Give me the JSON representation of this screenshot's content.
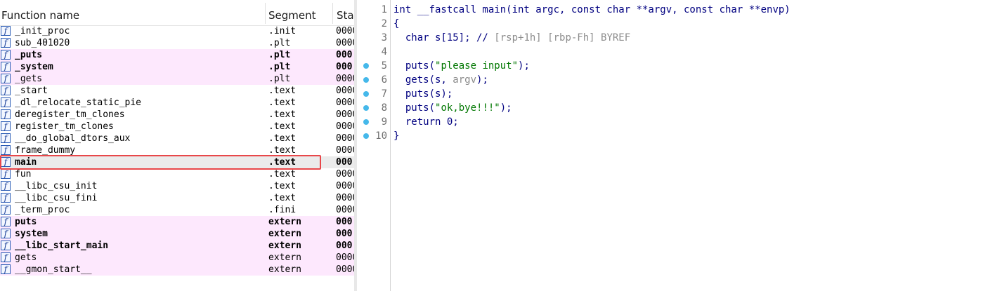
{
  "functions": {
    "columns": {
      "name": "Function name",
      "segment": "Segment",
      "start": "Start"
    },
    "rows": [
      {
        "name": "_init_proc",
        "segment": ".init",
        "start": "0000",
        "type": "normal"
      },
      {
        "name": "sub_401020",
        "segment": ".plt",
        "start": "0000",
        "type": "normal"
      },
      {
        "name": "_puts",
        "segment": ".plt",
        "start": "000",
        "type": "import"
      },
      {
        "name": "_system",
        "segment": ".plt",
        "start": "000",
        "type": "import"
      },
      {
        "name": "_gets",
        "segment": ".plt",
        "start": "0000",
        "type": "import-light"
      },
      {
        "name": "_start",
        "segment": ".text",
        "start": "0000",
        "type": "normal"
      },
      {
        "name": "_dl_relocate_static_pie",
        "segment": ".text",
        "start": "0000",
        "type": "normal"
      },
      {
        "name": "deregister_tm_clones",
        "segment": ".text",
        "start": "0000",
        "type": "normal"
      },
      {
        "name": "register_tm_clones",
        "segment": ".text",
        "start": "0000",
        "type": "normal"
      },
      {
        "name": "__do_global_dtors_aux",
        "segment": ".text",
        "start": "0000",
        "type": "normal"
      },
      {
        "name": "frame_dummy",
        "segment": ".text",
        "start": "0000",
        "type": "normal"
      },
      {
        "name": "main",
        "segment": ".text",
        "start": "000",
        "type": "selected"
      },
      {
        "name": "fun",
        "segment": ".text",
        "start": "0000",
        "type": "normal"
      },
      {
        "name": "__libc_csu_init",
        "segment": ".text",
        "start": "0000",
        "type": "normal"
      },
      {
        "name": "__libc_csu_fini",
        "segment": ".text",
        "start": "0000",
        "type": "normal"
      },
      {
        "name": "_term_proc",
        "segment": ".fini",
        "start": "0000",
        "type": "normal"
      },
      {
        "name": "puts",
        "segment": "extern",
        "start": "000",
        "type": "import"
      },
      {
        "name": "system",
        "segment": "extern",
        "start": "000",
        "type": "import"
      },
      {
        "name": "__libc_start_main",
        "segment": "extern",
        "start": "000",
        "type": "import"
      },
      {
        "name": "gets",
        "segment": "extern",
        "start": "0000",
        "type": "import-light"
      },
      {
        "name": "__gmon_start__",
        "segment": "extern",
        "start": "0000",
        "type": "import-light"
      }
    ]
  },
  "pseudocode": {
    "lines": [
      {
        "num": "1",
        "breakpoint": false,
        "parts": [
          {
            "t": "int __fastcall main(int argc, const char **argv, const char **envp)",
            "c": "code"
          }
        ]
      },
      {
        "num": "2",
        "breakpoint": false,
        "parts": [
          {
            "t": "{",
            "c": "code"
          }
        ]
      },
      {
        "num": "3",
        "breakpoint": false,
        "parts": [
          {
            "t": "  char s[15]; // ",
            "c": "code"
          },
          {
            "t": "[rsp+1h] [rbp-Fh] BYREF",
            "c": "gray"
          }
        ]
      },
      {
        "num": "4",
        "breakpoint": false,
        "parts": []
      },
      {
        "num": "5",
        "breakpoint": true,
        "parts": [
          {
            "t": "  puts(",
            "c": "code"
          },
          {
            "t": "\"please input\"",
            "c": "green"
          },
          {
            "t": ");",
            "c": "code"
          }
        ]
      },
      {
        "num": "6",
        "breakpoint": true,
        "parts": [
          {
            "t": "  gets(s, ",
            "c": "code"
          },
          {
            "t": "argv",
            "c": "gray"
          },
          {
            "t": ");",
            "c": "code"
          }
        ]
      },
      {
        "num": "7",
        "breakpoint": true,
        "parts": [
          {
            "t": "  puts(s);",
            "c": "code"
          }
        ]
      },
      {
        "num": "8",
        "breakpoint": true,
        "parts": [
          {
            "t": "  puts(",
            "c": "code"
          },
          {
            "t": "\"ok,bye!!!\"",
            "c": "green"
          },
          {
            "t": ");",
            "c": "code"
          }
        ]
      },
      {
        "num": "9",
        "breakpoint": true,
        "parts": [
          {
            "t": "  return 0;",
            "c": "code"
          }
        ]
      },
      {
        "num": "10",
        "breakpoint": true,
        "parts": [
          {
            "t": "}",
            "c": "code"
          }
        ]
      }
    ]
  },
  "colors": {
    "import_row_bg": "#fde8fd",
    "selected_row_bg": "#ebebeb",
    "highlight_border": "#e8474a",
    "code_text": "#000080",
    "string_literal": "#007700",
    "comment": "#8c8c8c",
    "breakpoint": "#45b8ea"
  },
  "icons": {
    "function_icon": "function-f-icon",
    "breakpoint_marker": "breakpoint-dot-icon"
  }
}
